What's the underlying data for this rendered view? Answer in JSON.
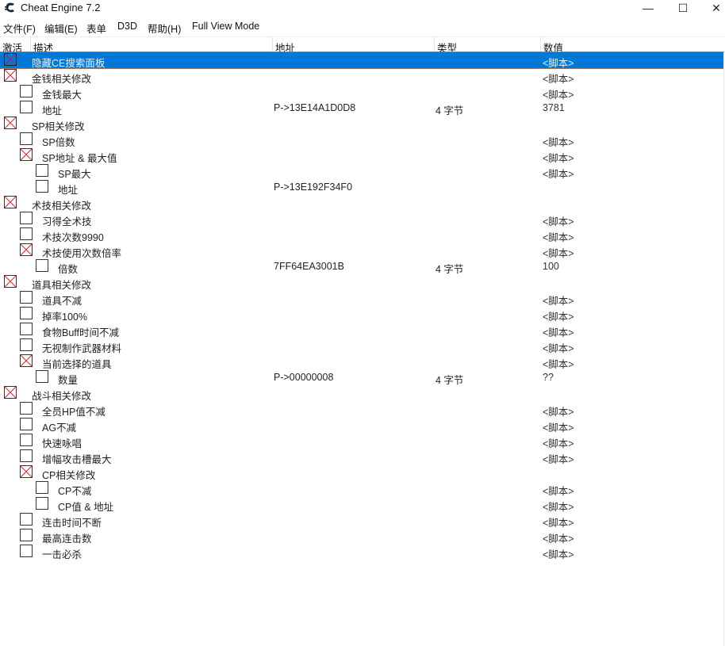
{
  "window": {
    "title": "Cheat Engine 7.2",
    "controls": {
      "minimize": "—",
      "maximize": "☐",
      "close": "✕"
    }
  },
  "menu": [
    "文件(F)",
    "编辑(E)",
    "表单",
    "D3D",
    "帮助(H)",
    "Full View Mode"
  ],
  "columns": {
    "active": "激活",
    "description": "描述",
    "address": "地址",
    "type": "类型",
    "value": "数值"
  },
  "colors": {
    "selection": "#0078d7",
    "check_mark": "#e8202a"
  },
  "rows": [
    {
      "level": 0,
      "checked": true,
      "selected": true,
      "description": "隐藏CE搜索面板",
      "address": "",
      "type": "",
      "value": "<脚本>"
    },
    {
      "level": 0,
      "checked": true,
      "description": "金钱相关修改",
      "address": "",
      "type": "",
      "value": "<脚本>"
    },
    {
      "level": 1,
      "checked": false,
      "description": "金钱最大",
      "address": "",
      "type": "",
      "value": "<脚本>"
    },
    {
      "level": 1,
      "checked": false,
      "description": "地址",
      "address": "P->13E14A1D0D8",
      "type": "4 字节",
      "value": "3781"
    },
    {
      "level": 0,
      "checked": true,
      "description": "SP相关修改",
      "address": "",
      "type": "",
      "value": ""
    },
    {
      "level": 1,
      "checked": false,
      "description": "SP倍数",
      "address": "",
      "type": "",
      "value": "<脚本>"
    },
    {
      "level": 1,
      "checked": true,
      "description": "SP地址 & 最大值",
      "address": "",
      "type": "",
      "value": "<脚本>"
    },
    {
      "level": 2,
      "checked": false,
      "description": "SP最大",
      "address": "",
      "type": "",
      "value": "<脚本>"
    },
    {
      "level": 2,
      "checked": false,
      "description": "地址",
      "address": "P->13E192F34F0",
      "type": "",
      "value": ""
    },
    {
      "level": 0,
      "checked": true,
      "description": "术技相关修改",
      "address": "",
      "type": "",
      "value": ""
    },
    {
      "level": 1,
      "checked": false,
      "description": "习得全术技",
      "address": "",
      "type": "",
      "value": "<脚本>"
    },
    {
      "level": 1,
      "checked": false,
      "description": "术技次数9990",
      "address": "",
      "type": "",
      "value": "<脚本>"
    },
    {
      "level": 1,
      "checked": true,
      "description": "术技使用次数倍率",
      "address": "",
      "type": "",
      "value": "<脚本>"
    },
    {
      "level": 2,
      "checked": false,
      "description": "倍数",
      "address": "7FF64EA3001B",
      "type": "4 字节",
      "value": "100"
    },
    {
      "level": 0,
      "checked": true,
      "description": "道具相关修改",
      "address": "",
      "type": "",
      "value": ""
    },
    {
      "level": 1,
      "checked": false,
      "description": "道具不减",
      "address": "",
      "type": "",
      "value": "<脚本>"
    },
    {
      "level": 1,
      "checked": false,
      "description": "掉率100%",
      "address": "",
      "type": "",
      "value": "<脚本>"
    },
    {
      "level": 1,
      "checked": false,
      "description": "食物Buff时间不减",
      "address": "",
      "type": "",
      "value": "<脚本>"
    },
    {
      "level": 1,
      "checked": false,
      "description": "无视制作武器材料",
      "address": "",
      "type": "",
      "value": "<脚本>"
    },
    {
      "level": 1,
      "checked": true,
      "description": "当前选择的道具",
      "address": "",
      "type": "",
      "value": "<脚本>"
    },
    {
      "level": 2,
      "checked": false,
      "description": "数量",
      "address": "P->00000008",
      "type": "4 字节",
      "value": "??"
    },
    {
      "level": 0,
      "checked": true,
      "description": "战斗相关修改",
      "address": "",
      "type": "",
      "value": ""
    },
    {
      "level": 1,
      "checked": false,
      "description": "全员HP值不减",
      "address": "",
      "type": "",
      "value": "<脚本>"
    },
    {
      "level": 1,
      "checked": false,
      "description": "AG不减",
      "address": "",
      "type": "",
      "value": "<脚本>"
    },
    {
      "level": 1,
      "checked": false,
      "description": "快速咏唱",
      "address": "",
      "type": "",
      "value": "<脚本>"
    },
    {
      "level": 1,
      "checked": false,
      "description": "增幅攻击槽最大",
      "address": "",
      "type": "",
      "value": "<脚本>"
    },
    {
      "level": 1,
      "checked": true,
      "description": "CP相关修改",
      "address": "",
      "type": "",
      "value": ""
    },
    {
      "level": 2,
      "checked": false,
      "description": "CP不减",
      "address": "",
      "type": "",
      "value": "<脚本>"
    },
    {
      "level": 2,
      "checked": false,
      "description": "CP值 & 地址",
      "address": "",
      "type": "",
      "value": "<脚本>"
    },
    {
      "level": 1,
      "checked": false,
      "description": "连击时间不断",
      "address": "",
      "type": "",
      "value": "<脚本>"
    },
    {
      "level": 1,
      "checked": false,
      "description": "最高连击数",
      "address": "",
      "type": "",
      "value": "<脚本>"
    },
    {
      "level": 1,
      "checked": false,
      "description": "一击必杀",
      "address": "",
      "type": "",
      "value": "<脚本>"
    }
  ]
}
